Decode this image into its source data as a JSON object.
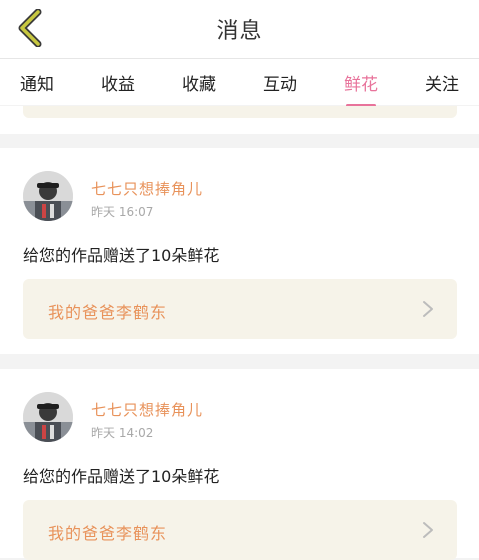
{
  "header": {
    "title": "消息",
    "back_icon": "chevron-left-icon",
    "back_color": "#c8c840"
  },
  "tabs": [
    {
      "label": "通知",
      "active": false
    },
    {
      "label": "收益",
      "active": false
    },
    {
      "label": "收藏",
      "active": false
    },
    {
      "label": "互动",
      "active": false
    },
    {
      "label": "鲜花",
      "active": true
    },
    {
      "label": "关注",
      "active": false
    }
  ],
  "accent_color": "#e8739b",
  "notifications": [
    {
      "username": "七七只想捧角儿",
      "time": "昨天 16:07",
      "message": "给您的作品赠送了10朵鲜花",
      "work_title": "我的爸爸李鹤东"
    },
    {
      "username": "七七只想捧角儿",
      "time": "昨天 14:02",
      "message": "给您的作品赠送了10朵鲜花",
      "work_title": "我的爸爸李鹤东"
    }
  ]
}
